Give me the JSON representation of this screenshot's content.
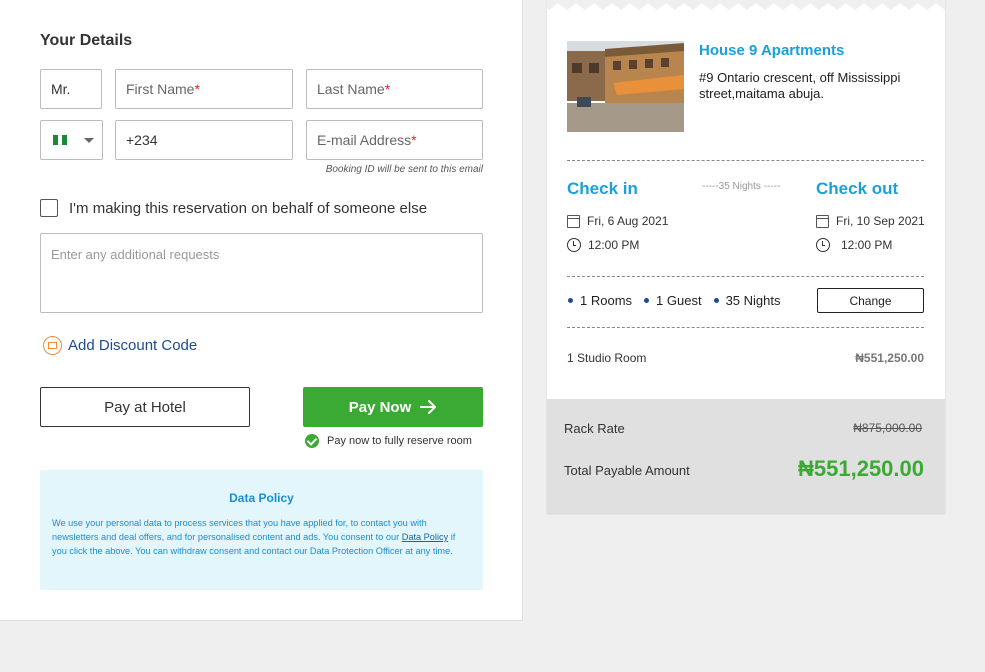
{
  "details": {
    "title": "Your Details",
    "salutation": "Mr.",
    "first_name_placeholder": "First Name",
    "last_name_placeholder": "Last Name",
    "country_code": "+234",
    "email_placeholder": "E-mail Address",
    "required_mark": "*",
    "email_hint": "Booking ID will be sent to this email",
    "behalf_label": "I'm making this reservation on behalf of someone else",
    "requests_placeholder": "Enter any additional requests",
    "discount_label": "Add Discount Code",
    "pay_hotel_label": "Pay at Hotel",
    "pay_now_label": "Pay Now",
    "pay_note": "Pay now to fully reserve room"
  },
  "policy": {
    "title": "Data Policy",
    "text_before_link": "We use your personal data to process services that you have applied for, to contact you with newsletters and deal offers, and for personalised content and ads. You consent to our ",
    "link": "Data Policy",
    "text_after_link": " if you click the above. You can withdraw consent and contact our Data Protection Officer at any time."
  },
  "booking": {
    "hotel_name": "House 9 Apartments",
    "address": "#9 Ontario crescent, off Mississippi street,maitama abuja.",
    "check_in_title": "Check in",
    "check_out_title": "Check out",
    "nights_between": "-----35 Nights -----",
    "check_in_date": "Fri, 6 Aug 2021",
    "check_in_time": "12:00 PM",
    "check_out_date": "Fri, 10 Sep 2021",
    "check_out_time": "12:00 PM",
    "rooms": "1 Rooms",
    "guests": "1 Guest",
    "nights": "35 Nights",
    "change_label": "Change",
    "room_line": "1 Studio Room",
    "room_price": "₦551,250.00",
    "rack_rate_label": "Rack Rate",
    "rack_rate_value": "₦875,000.00",
    "total_label": "Total Payable Amount",
    "total_value": "₦551,250.00"
  },
  "colors": {
    "accent_blue": "#1aa0db",
    "primary_green": "#3aaa35",
    "link_navy": "#1d4b8f",
    "required_red": "#e0242d",
    "policy_bg": "#e3f6fc"
  },
  "icons": {
    "flag": "nigeria-flag-icon",
    "dropdown": "chevron-down-icon",
    "discount": "coupon-icon",
    "pay_arrow": "arrow-right-icon",
    "note_check": "check-circle-icon",
    "date": "calendar-icon",
    "time": "clock-icon"
  }
}
